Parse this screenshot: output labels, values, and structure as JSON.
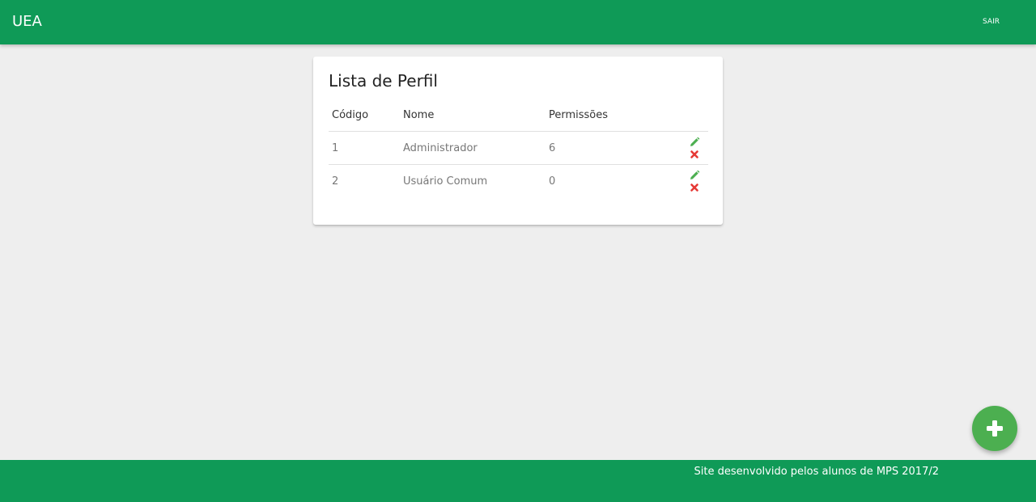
{
  "header": {
    "brand": "UEA",
    "logout_label": "SAIR"
  },
  "card": {
    "title": "Lista de Perfil",
    "columns": [
      "Código",
      "Nome",
      "Permissões"
    ],
    "rows": [
      {
        "code": "1",
        "name": "Administrador",
        "permissions": "6"
      },
      {
        "code": "2",
        "name": "Usuário Comum",
        "permissions": "0"
      }
    ]
  },
  "footer": {
    "text": "Site desenvolvido pelos alunos de MPS 2017/2"
  },
  "icons": {
    "edit": "pencil-icon",
    "delete": "close-icon",
    "add": "plus-icon"
  },
  "colors": {
    "primary": "#0f9a57",
    "fab": "#4caf50",
    "edit": "#4caf50",
    "delete": "#e53935",
    "background": "#eeeeee"
  }
}
